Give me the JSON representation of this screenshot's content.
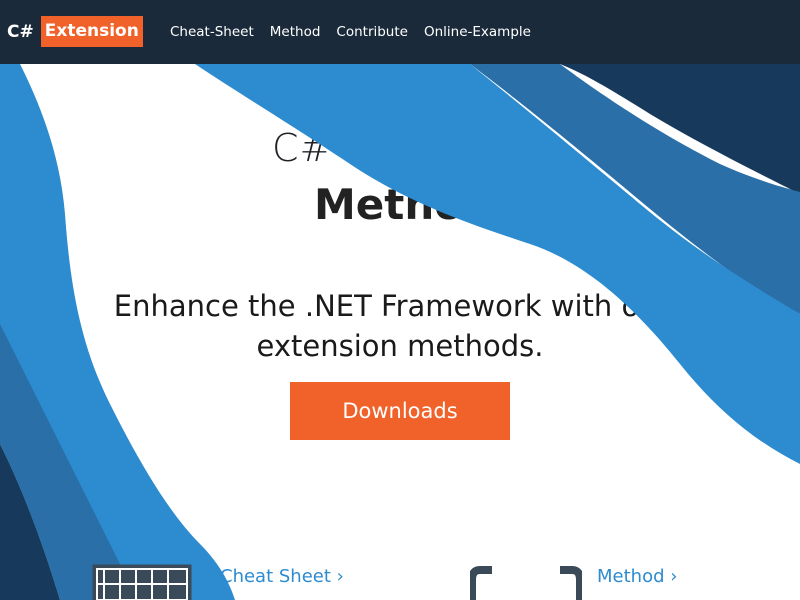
{
  "brand": {
    "prefix": "C#",
    "name": "Extension"
  },
  "nav": {
    "items": [
      {
        "label": "Cheat-Sheet"
      },
      {
        "label": "Method"
      },
      {
        "label": "Contribute"
      },
      {
        "label": "Online-Example"
      }
    ]
  },
  "hero": {
    "title_line1": "C#",
    "title_line2": "Methods",
    "subtitle_line1": "Enhance the .NET Framework with over",
    "subtitle_line2": "extension methods.",
    "download_label": "Downloads"
  },
  "features": [
    {
      "label": "Cheat Sheet ›",
      "icon": "grid-icon"
    },
    {
      "label": "Method ›",
      "icon": "braces-icon"
    }
  ],
  "colors": {
    "navbar": "#1b2a3a",
    "accent": "#f0622a",
    "wave_blue": "#2d8bd0",
    "wave_mid": "#2a6fa8",
    "wave_dark": "#173a5c"
  }
}
